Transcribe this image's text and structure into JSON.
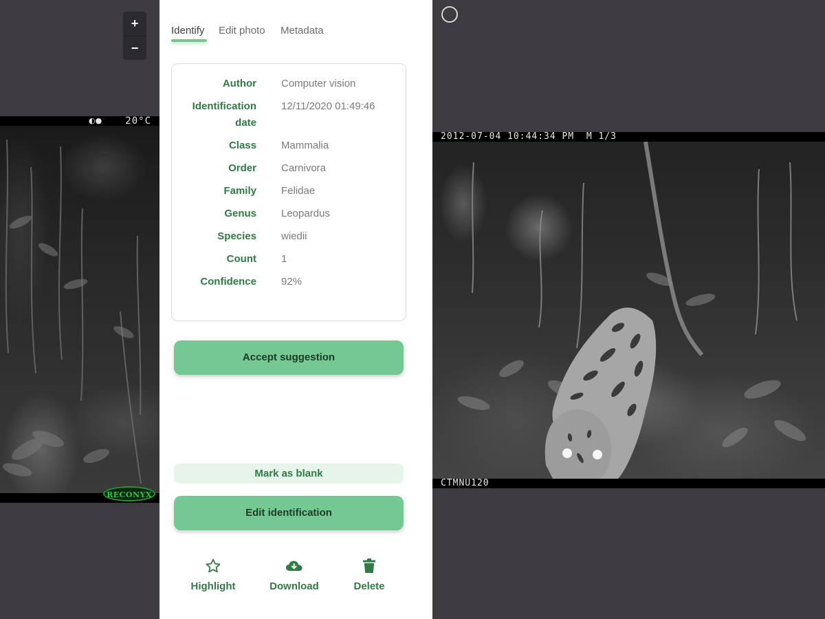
{
  "zoom": {
    "in_label": "+",
    "out_label": "−"
  },
  "left_photo": {
    "temperature": "20°C",
    "moon_phase": "◐●",
    "brand": "RECONYX"
  },
  "tabs": [
    {
      "label": "Identify",
      "active": true
    },
    {
      "label": "Edit photo",
      "active": false
    },
    {
      "label": "Metadata",
      "active": false
    }
  ],
  "identification": {
    "author_label": "Author",
    "author": "Computer vision",
    "date_label_1": "Identification",
    "date_label_2": "date",
    "date": "12/11/2020 01:49:46",
    "class_label": "Class",
    "class": "Mammalia",
    "order_label": "Order",
    "order": "Carnivora",
    "family_label": "Family",
    "family": "Felidae",
    "genus_label": "Genus",
    "genus": "Leopardus",
    "species_label": "Species",
    "species": "wiedii",
    "count_label": "Count",
    "count": "1",
    "confidence_label": "Confidence",
    "confidence": "92%"
  },
  "buttons": {
    "accept": "Accept suggestion",
    "mark_blank": "Mark as blank",
    "edit": "Edit identification"
  },
  "actions": {
    "highlight": {
      "label": "Highlight",
      "icon": "star-icon"
    },
    "download": {
      "label": "Download",
      "icon": "cloud-download-icon"
    },
    "delete": {
      "label": "Delete",
      "icon": "trash-icon"
    }
  },
  "right_photo": {
    "timestamp": "2012-07-04 10:44:34 PM  M 1/3",
    "camera_id": "CTMNU120"
  },
  "colors": {
    "accent": "#74c891",
    "label_green": "#2f7a45",
    "soft_green": "#e6f4ea",
    "background": "#3d3b3f"
  }
}
